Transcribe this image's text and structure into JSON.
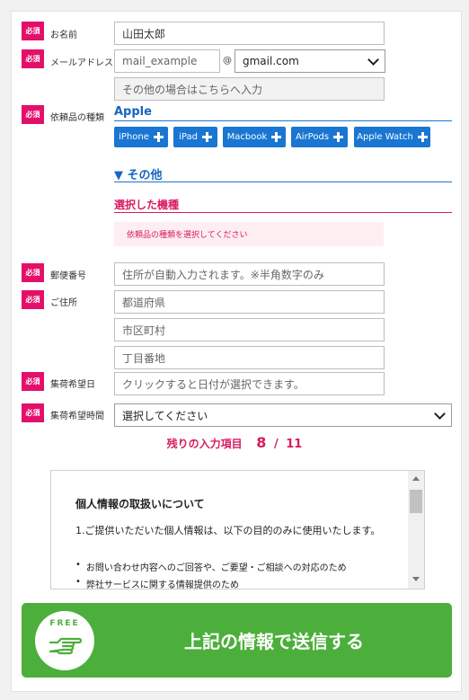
{
  "required_badge": "必須",
  "fields": {
    "name": {
      "label": "お名前",
      "value": "山田太郎"
    },
    "email": {
      "label": "メールアドレス",
      "local_placeholder": "mail_example",
      "at": "@",
      "domain_selected": "gmail.com",
      "other_placeholder": "その他の場合はこちらへ入力"
    },
    "device_type": {
      "label": "依頼品の種類"
    },
    "postal": {
      "label": "郵便番号",
      "placeholder": "住所が自動入力されます。※半角数字のみ"
    },
    "address": {
      "label": "ご住所",
      "prefecture_placeholder": "都道府県",
      "city_placeholder": "市区町村",
      "street_placeholder": "丁目番地"
    },
    "pickup_date": {
      "label": "集荷希望日",
      "placeholder": "クリックすると日付が選択できます。"
    },
    "pickup_time": {
      "label": "集荷希望時間",
      "selected": "選択してください"
    }
  },
  "apple_section": {
    "title": "Apple",
    "chips": [
      "iPhone",
      "iPad",
      "Macbook",
      "AirPods",
      "Apple Watch"
    ]
  },
  "other_section": {
    "title": "▼ その他"
  },
  "selected_section": {
    "title": "選択した機種",
    "empty_message": "依頼品の種類を選択してください"
  },
  "remaining": {
    "label": "残りの入力項目",
    "count": "8",
    "separator": "/",
    "total": "11"
  },
  "privacy": {
    "heading": "個人情報の取扱いについて",
    "paragraph": "1.ご提供いただいた個人情報は、以下の目的のみに使用いたします。",
    "items": [
      "お問い合わせ内容へのご回答や、ご要望・ご相談への対応のため",
      "弊社サービスに関する情報提供のため"
    ]
  },
  "submit": {
    "free_label": "FREE",
    "label": "上記の情報で送信する"
  },
  "colors": {
    "accent": "#e3106a",
    "blue": "#1976d2",
    "green": "#4caf3b"
  }
}
